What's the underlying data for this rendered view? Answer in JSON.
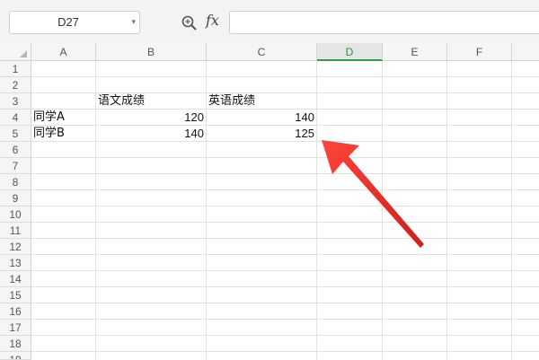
{
  "formula_bar": {
    "name_box": "D27",
    "fx_label": "fx",
    "formula_value": ""
  },
  "columns": [
    {
      "label": "A",
      "active": false
    },
    {
      "label": "B",
      "active": false
    },
    {
      "label": "C",
      "active": false
    },
    {
      "label": "D",
      "active": true
    },
    {
      "label": "E",
      "active": false
    },
    {
      "label": "F",
      "active": false
    }
  ],
  "rows": [
    "1",
    "2",
    "3",
    "4",
    "5",
    "6",
    "7",
    "8",
    "9",
    "10",
    "11",
    "12",
    "13",
    "14",
    "15",
    "16",
    "17",
    "18",
    "19"
  ],
  "cells": {
    "B3": "语文成绩",
    "C3": "英语成绩",
    "A4": "同学A",
    "B4": "120",
    "C4": "140",
    "A5": "同学B",
    "B5": "140",
    "C5": "125"
  },
  "colors": {
    "accent_green": "#2e9e49",
    "arrow_red": "#e8211c"
  },
  "icons": {
    "zoom": "zoom-formula-icon",
    "annotation": "red-arrow-annotation"
  }
}
